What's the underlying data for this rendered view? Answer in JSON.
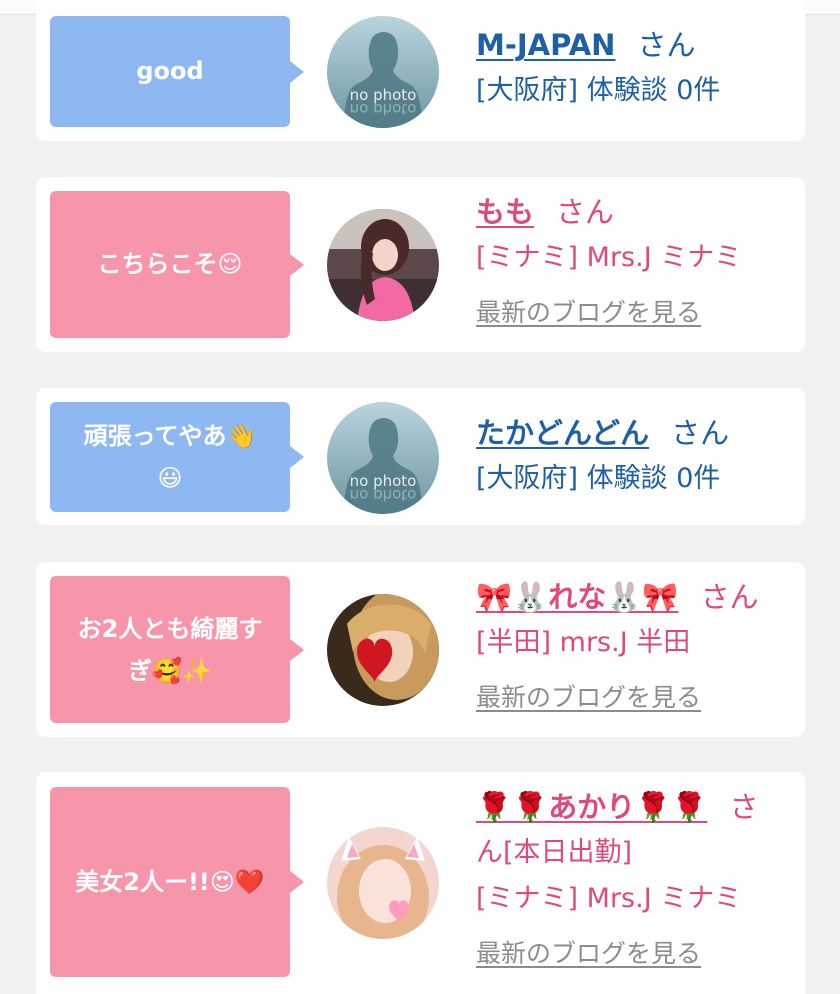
{
  "colors": {
    "card_bg": "#ffffff",
    "page_bg": "#f2f2f2",
    "bubble_blue": "#8db8f2",
    "bubble_pink": "#f796aa",
    "name_blue": "#1f5fa6",
    "name_pink": "#de4a7c",
    "link_gray": "#8c8c8c"
  },
  "comments": [
    {
      "message": "good",
      "user_type": "member",
      "avatar": "no-photo-silhouette",
      "avatar_caption": "no photo",
      "name": "M-JAPAN",
      "honorific": "さん",
      "meta": "[大阪府] 体験談 0件"
    },
    {
      "message": "こちらこそ😌",
      "user_type": "cast",
      "avatar": "cast-photo-momo",
      "name": "もも",
      "honorific": "さん",
      "meta": "[ミナミ] Mrs.J ミナミ",
      "blog_link": "最新のブログを見る"
    },
    {
      "message_line1": "頑張ってやあ👋",
      "message_line2": "😃",
      "user_type": "member",
      "avatar": "no-photo-silhouette",
      "avatar_caption": "no photo",
      "name": "たかどんどん",
      "honorific": "さん",
      "meta": "[大阪府] 体験談 0件"
    },
    {
      "message_line1": "お2人とも綺麗す",
      "message_line2": "ぎ🥰✨",
      "user_type": "cast",
      "avatar": "cast-photo-rena-heart",
      "name": "🎀🐰れな🐰🎀",
      "honorific": "さん",
      "meta": "[半田] mrs.J 半田",
      "blog_link": "最新のブログを見る"
    },
    {
      "message": "美女2人ー!!😍❤️",
      "user_type": "cast",
      "avatar": "cast-photo-akari-cat-filter",
      "name": "🌹🌹あかり🌹🌹",
      "honorific_part1": "さ",
      "honorific_part2": "ん",
      "status": "[本日出勤]",
      "meta": "[ミナミ] Mrs.J ミナミ",
      "blog_link": "最新のブログを見る"
    }
  ]
}
